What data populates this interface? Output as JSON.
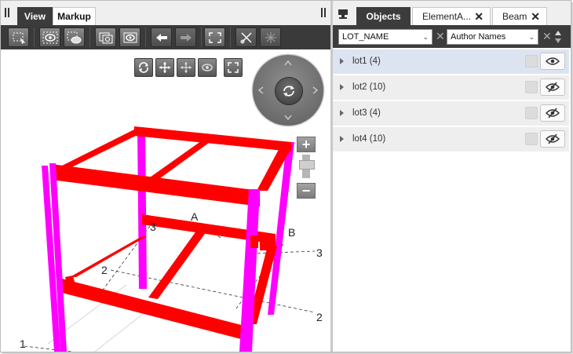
{
  "viewer": {
    "tabs": [
      {
        "label": "View",
        "active": true
      },
      {
        "label": "Markup",
        "active": false
      }
    ],
    "toolbar_icons": [
      "select-area-icon",
      "isolate-icon",
      "hide-icon",
      "snapshot-icon",
      "saved-views-icon",
      "undo-icon",
      "redo-icon",
      "fit-view-icon",
      "clip-plane-icon",
      "clip-box-icon"
    ],
    "view_controls": [
      "orbit-icon",
      "pan-icon",
      "pan-alt-icon",
      "look-around-icon",
      "fullscreen-icon"
    ],
    "grid_labels": {
      "a": "A",
      "b": "B",
      "c": "3",
      "d": "3",
      "e": "2",
      "f": "2",
      "g": "1"
    },
    "colors": {
      "beams": "#ff0000",
      "columns": "#ff00ff"
    }
  },
  "panel": {
    "tabs": [
      {
        "label": "Objects",
        "active": true,
        "closable": false
      },
      {
        "label": "ElementA...",
        "active": false,
        "closable": true
      },
      {
        "label": "Beam",
        "active": false,
        "closable": true
      }
    ],
    "filter": {
      "property": "LOT_NAME",
      "group_by": "Author Names"
    },
    "items": [
      {
        "label": "lot1 (4)",
        "selected": true,
        "visible": true
      },
      {
        "label": "lot2 (10)",
        "selected": false,
        "visible": false
      },
      {
        "label": "lot3 (4)",
        "selected": false,
        "visible": false
      },
      {
        "label": "lot4 (10)",
        "selected": false,
        "visible": false
      }
    ]
  }
}
